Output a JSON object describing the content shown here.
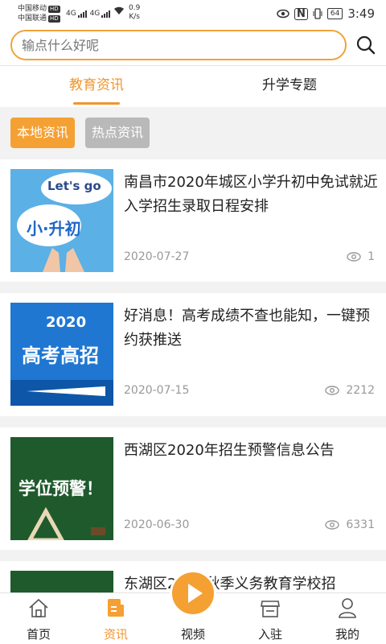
{
  "status": {
    "carrier1": "中国移动",
    "carrier2": "中国联通",
    "hd": "HD",
    "net1": "4G",
    "net2": "4G",
    "speed_value": "0.9",
    "speed_unit": "K/s",
    "battery": "64",
    "time": "3:49"
  },
  "search": {
    "placeholder": "输点什么好呢"
  },
  "tabs": [
    {
      "label": "教育资讯",
      "active": true
    },
    {
      "label": "升学专题",
      "active": false
    }
  ],
  "chips": [
    {
      "label": "本地资讯",
      "active": true
    },
    {
      "label": "热点资讯",
      "active": false
    }
  ],
  "news": [
    {
      "title": "南昌市2020年城区小学升初中免试就近入学招生录取日程安排",
      "date": "2020-07-27",
      "views": "1",
      "thumb": {
        "line1": "Let's go",
        "line2": "小·升初"
      }
    },
    {
      "title": "好消息！高考成绩不查也能知，一键预约获推送",
      "date": "2020-07-15",
      "views": "2212",
      "thumb": {
        "line1": "2020",
        "line2": "高考高招"
      }
    },
    {
      "title": "西湖区2020年招生预警信息公告",
      "date": "2020-06-30",
      "views": "6331",
      "thumb": {
        "line1": "学位预警！"
      }
    },
    {
      "title": "东湖区2　年秋季义务教育学校招",
      "date": "",
      "views": ""
    }
  ],
  "nav": [
    {
      "label": "首页",
      "icon": "home-icon",
      "active": false
    },
    {
      "label": "资讯",
      "icon": "news-icon",
      "active": true
    },
    {
      "label": "视频",
      "icon": "play-icon",
      "active": false
    },
    {
      "label": "入驻",
      "icon": "store-icon",
      "active": false
    },
    {
      "label": "我的",
      "icon": "user-icon",
      "active": false
    }
  ],
  "colors": {
    "accent": "#f0952d",
    "chip_active": "#f5a033",
    "chip_inactive": "#b9b9b9"
  }
}
